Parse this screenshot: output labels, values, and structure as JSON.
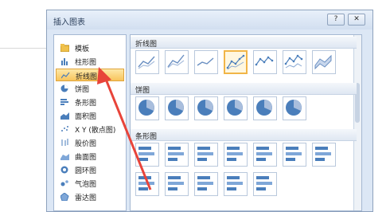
{
  "dialog": {
    "title": "插入图表",
    "help_button": "?",
    "close_button": "✕"
  },
  "sidebar": {
    "items": [
      {
        "label": "模板",
        "icon": "folder-icon"
      },
      {
        "label": "柱形图",
        "icon": "column-chart-icon"
      },
      {
        "label": "折线图",
        "icon": "line-chart-icon",
        "selected": true
      },
      {
        "label": "饼图",
        "icon": "pie-chart-icon"
      },
      {
        "label": "条形图",
        "icon": "bar-chart-icon"
      },
      {
        "label": "面积图",
        "icon": "area-chart-icon"
      },
      {
        "label": "X Y (散点图)",
        "icon": "scatter-chart-icon"
      },
      {
        "label": "股价图",
        "icon": "stock-chart-icon"
      },
      {
        "label": "曲面图",
        "icon": "surface-chart-icon"
      },
      {
        "label": "圆环图",
        "icon": "doughnut-chart-icon"
      },
      {
        "label": "气泡图",
        "icon": "bubble-chart-icon"
      },
      {
        "label": "雷达图",
        "icon": "radar-chart-icon"
      }
    ]
  },
  "gallery": {
    "sections": [
      {
        "label": "折线图",
        "count": 7,
        "selected_index": 3
      },
      {
        "label": "饼图",
        "count": 6
      },
      {
        "label": "条形图",
        "count": 12
      }
    ]
  },
  "colors": {
    "accent": "#f1b547",
    "arrow": "#e8443a",
    "dialog_bg": "#dce7f5"
  }
}
